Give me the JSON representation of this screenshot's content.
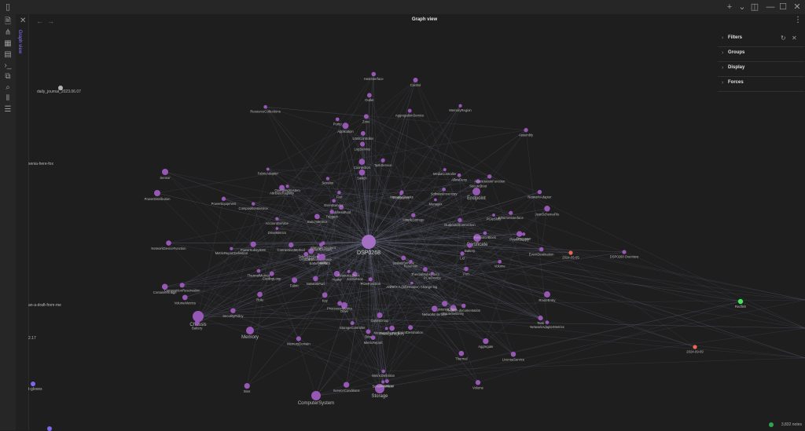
{
  "window": {
    "sidebar_toggle": "▯",
    "new_tab": "+",
    "dropdown": "⌄",
    "layout": "◫",
    "minimize": "—",
    "maximize": "☐",
    "close": "✕"
  },
  "ribbon": [
    {
      "name": "files-icon",
      "glyph": "🗎"
    },
    {
      "name": "graph-icon",
      "glyph": "⋔"
    },
    {
      "name": "canvas-icon",
      "glyph": "▦"
    },
    {
      "name": "calendar-icon",
      "glyph": "▤"
    },
    {
      "name": "terminal-icon",
      "glyph": "›_"
    },
    {
      "name": "template-icon",
      "glyph": "⧉"
    },
    {
      "name": "search-icon",
      "glyph": "⌕"
    },
    {
      "name": "audio-icon",
      "glyph": "⦀"
    },
    {
      "name": "properties-icon",
      "glyph": "☰"
    }
  ],
  "sidebar": {
    "close": "✕",
    "tab_label": "Graph view"
  },
  "view": {
    "title": "Graph view",
    "back": "←",
    "forward": "→",
    "more": "⋮"
  },
  "controls": {
    "sections": [
      {
        "name": "filters",
        "label": "Filters"
      },
      {
        "name": "groups",
        "label": "Groups"
      },
      {
        "name": "display",
        "label": "Display"
      },
      {
        "name": "forces",
        "label": "Forces"
      }
    ],
    "reset_icon": "↻",
    "close_icon": "✕"
  },
  "outside_labels": [
    {
      "name": "daily-journal-label",
      "text": "daily_journal_2023.06.07"
    },
    {
      "name": "xenia-here-fox-label",
      "text": "xenia-here-fox"
    },
    {
      "name": "an-a-draft-label",
      "text": "an-a-draft-from-me"
    },
    {
      "name": "version-label",
      "text": "2.17"
    },
    {
      "name": "t-gloves-label",
      "text": "t-gloves"
    }
  ],
  "status": {
    "sync": "",
    "words": "3,832 notes"
  },
  "colors": {
    "node": "#9658b4",
    "node_alt": "#a56fc4",
    "green": "#3ee85f",
    "red": "#e8685a",
    "grey": "#b4b4b4",
    "edge": "#6b6f8a"
  },
  "graph": {
    "hub": {
      "name": "DSP0268",
      "label": "DSP0268"
    },
    "secondary_hubs": [
      {
        "label": "Chassis"
      },
      {
        "label": "ComputerSystem"
      },
      {
        "label": "Storage"
      },
      {
        "label": "Endpoint"
      },
      {
        "label": "Certificate"
      },
      {
        "label": "PowerDistribution"
      },
      {
        "label": "Sensor"
      },
      {
        "label": "Memory"
      },
      {
        "label": "Drive"
      }
    ],
    "nodes": [
      "MetricReportDefinition",
      "MetricReport",
      "Task",
      "Fabric",
      "AddressPool",
      "MetricDefinition",
      "CompositionService",
      "RouteEntry",
      "RouteSetEntry",
      "EventDestination",
      "Session",
      "ResourceBlock",
      "AccountService",
      "TaskService",
      "NetworkAdapterMetrics",
      "AllowDeny",
      "AttributeRegistry",
      "EventService",
      "CertificateService",
      "SecurityPolicy",
      "OutboundConnection",
      "PowerSubsystem",
      "ThermalMetrics",
      "SerialInterface",
      "ServiceConditions",
      "JsonSchemaFile",
      "Zone",
      "Lid",
      "PrivilegeRegistry",
      "Switch",
      "Battery",
      "BatteryMetrics",
      "CompositionReservation",
      "TelemetryService",
      "Manager",
      "Thermal",
      "ResourceCollections",
      "PortMetrics",
      "UpdateService",
      "MemoryRegion",
      "ManagerAccount",
      "PowerDomain",
      "OutletGroup",
      "ANNEX A (informative) Change log",
      "Triggers",
      "Redfish documentation",
      "EventDestination",
      "Connection",
      "Pump",
      "Heater",
      "Reservoir",
      "JobService",
      "CoolingLoop",
      "SecureBoot",
      "LicenseService",
      "NetworkDeviceFunction",
      "ContainerImage",
      "Role",
      "Control",
      "PowerSupply",
      "Facility",
      "PowerEquipment",
      "Outlet",
      "VolumeMetrics",
      "Port",
      "Processor",
      "Fan",
      "DriveMetrics",
      "PCIeSlots",
      "NetworkPort",
      "Container",
      "AccelerationFunction",
      "MemoryChunks",
      "Battery",
      "ThermalSubsystem",
      "Bios",
      "ResourceBlock",
      "LogService",
      "SimpleStorage",
      "MessageRegistry",
      "Aggregate",
      "Volume",
      "Key",
      "ConnectionMethod",
      "Assembly",
      "NetworkAdapter",
      "PCIeDevice",
      "Application",
      "StorageController",
      "Volume",
      "AggregationService",
      "SwitchMetrics",
      "EthernetInterface",
      "MemoryDomain",
      "RegisteredClient",
      "USBController",
      "OperatingSystem",
      "NetworkInterface",
      "HostInterface",
      "MediaController",
      "SoftwareInventory",
      "PCIeFunction",
      "Bios",
      "FabricAdapter",
      "LogEntry",
      "ProcessorMetrics",
      "2024-05-05",
      "DSP0268 Overview",
      "Redfish",
      "2024-09-09"
    ]
  }
}
